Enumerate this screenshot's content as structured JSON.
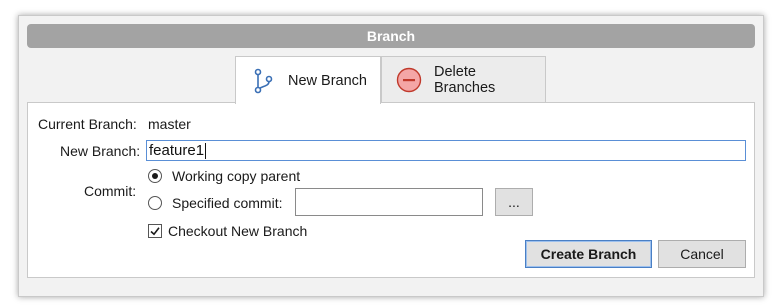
{
  "window": {
    "title": "Branch"
  },
  "tabs": [
    {
      "label": "New Branch",
      "icon": "branch-icon",
      "active": true
    },
    {
      "label": "Delete Branches",
      "icon": "minus-circle-icon",
      "active": false
    }
  ],
  "form": {
    "current_branch_label": "Current Branch:",
    "current_branch_value": "master",
    "new_branch_label": "New Branch:",
    "new_branch_value": "feature1",
    "commit_label": "Commit:",
    "working_copy_parent_label": "Working copy parent",
    "working_copy_parent_checked": true,
    "specified_commit_label": "Specified commit:",
    "specified_commit_value": "",
    "browse_label": "...",
    "checkout_label": "Checkout New Branch",
    "checkout_checked": true
  },
  "buttons": {
    "create_label": "Create Branch",
    "cancel_label": "Cancel"
  },
  "colors": {
    "titlebar": "#a3a3a3",
    "branch_icon": "#3a6fb5",
    "delete_icon_fill": "#f4a6a6",
    "delete_icon_stroke": "#c0392b",
    "default_button_border": "#4a7fc4"
  }
}
